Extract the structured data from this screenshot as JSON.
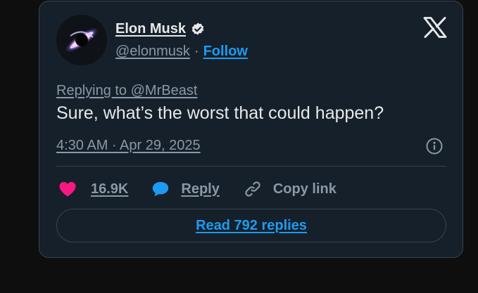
{
  "author": {
    "display_name": "Elon Musk",
    "handle": "@elonmusk",
    "separator": "·",
    "follow_label": "Follow",
    "avatar_icon": "black-hole-avatar",
    "verified_icon": "verified-badge-icon"
  },
  "tweet": {
    "replying_to": "Replying to @MrBeast",
    "text": "Sure, what’s the worst that could happen?",
    "timestamp": "4:30 AM · Apr 29, 2025"
  },
  "actions": {
    "like_count": "16.9K",
    "reply_label": "Reply",
    "copy_link_label": "Copy link"
  },
  "footer": {
    "read_replies_label": "Read 792 replies"
  },
  "icons": {
    "brand": "x-logo-icon",
    "info": "info-icon",
    "like": "heart-icon",
    "reply": "reply-bubble-icon",
    "copy": "link-icon"
  },
  "colors": {
    "page_background": "#0e0e0f",
    "card_background": "#15202b",
    "border": "#38444d",
    "primary_text": "#e7e9ea",
    "secondary_text": "#8b98a5",
    "accent_blue": "#1d9bf0",
    "like_pink": "#f91880"
  }
}
